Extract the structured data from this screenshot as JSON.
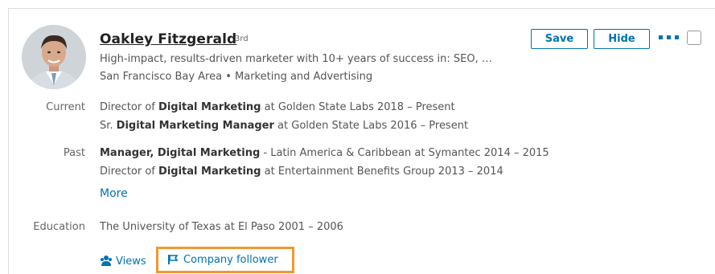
{
  "profile": {
    "name": "Oakley Fitzgerald",
    "degree": "3rd",
    "headline": "High-impact, results-driven marketer with 10+ years of success in: SEO, …",
    "location": "San Francisco Bay Area",
    "separator": "•",
    "industry": "Marketing and Advertising"
  },
  "actions": {
    "save_label": "Save",
    "hide_label": "Hide"
  },
  "current": {
    "label": "Current",
    "items": [
      {
        "pre": "Director of ",
        "bold": "Digital Marketing",
        "post": " at Golden State Labs  2018 – Present"
      },
      {
        "pre": "Sr. ",
        "bold": "Digital Marketing Manager",
        "post": " at Golden State Labs  2016 – Present"
      }
    ]
  },
  "past": {
    "label": "Past",
    "items": [
      {
        "pre": "",
        "bold": "Manager, Digital Marketing",
        "post": " - Latin America & Caribbean at Symantec  2014 – 2015"
      },
      {
        "pre": "Director of ",
        "bold": "Digital Marketing",
        "post": " at Entertainment Benefits Group  2013 – 2014"
      }
    ],
    "more_label": "More"
  },
  "education": {
    "label": "Education",
    "value": "The University of Texas at El Paso  2001 – 2006"
  },
  "insights": {
    "views_label": "Views",
    "follower_label": "Company follower"
  },
  "colors": {
    "link": "#0073b1",
    "highlight": "#f0982f"
  },
  "icons": {
    "views": "people-icon",
    "follower": "flag-icon",
    "more": "ellipsis-icon"
  }
}
